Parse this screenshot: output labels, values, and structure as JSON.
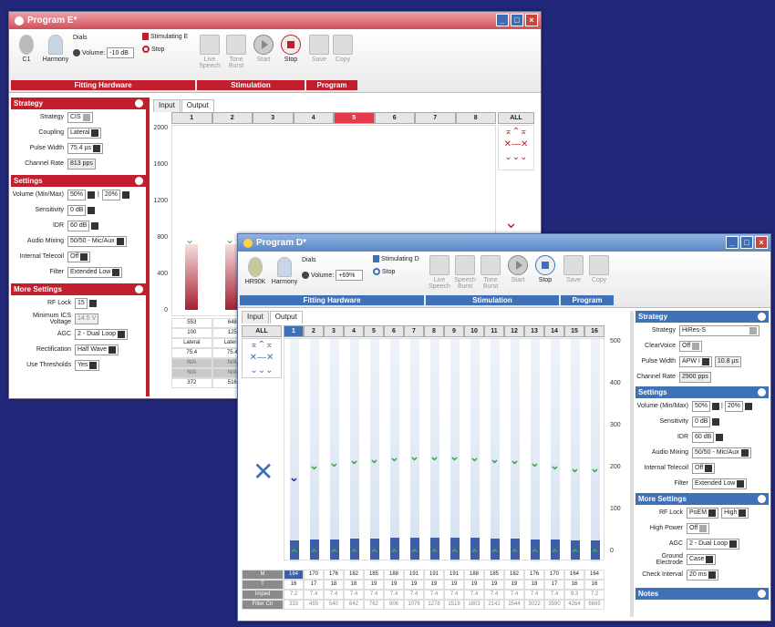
{
  "colors": {
    "red": "#c21f2e",
    "blue": "#3f71b8",
    "desktop": "#23297a"
  },
  "winE": {
    "title": "Program E*",
    "toolbar": {
      "implant": "C1",
      "processor": "Harmony",
      "dials_label": "Dials",
      "volume_label": "Volume:",
      "volume_value": "-10 dB",
      "stimulating": "Stimulating E",
      "stop_radio": "Stop",
      "live_speech": "Live Speech",
      "tone_burst": "Tone Burst",
      "start": "Start",
      "stop": "Stop",
      "save": "Save",
      "copy": "Copy",
      "group_fitting": "Fitting Hardware",
      "group_stim": "Stimulation",
      "group_program": "Program"
    },
    "strategy": {
      "header": "Strategy",
      "strategy_label": "Strategy",
      "strategy_value": "CIS",
      "coupling_label": "Coupling",
      "coupling_value": "Lateral",
      "pulse_label": "Pulse Width",
      "pulse_value": "75.4 µs",
      "rate_label": "Channel Rate",
      "rate_value": "813 pps"
    },
    "settings": {
      "header": "Settings",
      "volume_label": "Volume (Min/Max)",
      "vol_min": "50%",
      "vol_max": "20%",
      "sens_label": "Sensitivity",
      "sens_value": "0 dB",
      "idr_label": "IDR",
      "idr_value": "60 dB",
      "mix_label": "Audio Mixing",
      "mix_value": "50/50 - Mic/Aux",
      "tele_label": "Internal Telecoil",
      "tele_value": "Off",
      "filter_label": "Filter",
      "filter_value": "Extended Low"
    },
    "more": {
      "header": "More Settings",
      "rf_label": "RF Lock",
      "rf_value": "15",
      "ics_label": "Minimum ICS Voltage",
      "ics_value": "14.5 V",
      "agc_label": "AGC",
      "agc_value": "2 - Dual Loop",
      "rect_label": "Rectification",
      "rect_value": "Half Wave",
      "thresh_label": "Use Thresholds",
      "thresh_value": "Yes"
    },
    "tabs": [
      "Input",
      "Output"
    ],
    "channels": [
      "1",
      "2",
      "3",
      "4",
      "5",
      "6",
      "7",
      "8"
    ],
    "all_label": "ALL",
    "yticks": [
      "2000",
      "1600",
      "1200",
      "800",
      "400",
      "0"
    ],
    "rows": [
      [
        "553",
        "648"
      ],
      [
        "100",
        "125"
      ],
      [
        "Lateral",
        "Lateral"
      ],
      [
        "75.4",
        "75.4"
      ],
      [
        "N/A",
        "N/A"
      ],
      [
        "N/A",
        "N/A"
      ],
      [
        "372",
        "516"
      ]
    ]
  },
  "winD": {
    "title": "Program D*",
    "toolbar": {
      "implant": "HR90K",
      "processor": "Harmony",
      "dials_label": "Dials",
      "volume_label": "Volume:",
      "volume_value": "+69%",
      "stimulating": "Stimulating D",
      "stop_radio": "Stop",
      "live_speech": "Live Speech",
      "speech_burst": "Speech Burst",
      "tone_burst": "Tone Burst",
      "start": "Start",
      "stop": "Stop",
      "save": "Save",
      "copy": "Copy",
      "group_fitting": "Fitting Hardware",
      "group_stim": "Stimulation",
      "group_program": "Program"
    },
    "tabs": [
      "Input",
      "Output"
    ],
    "all_label": "ALL",
    "channels": [
      "1",
      "2",
      "3",
      "4",
      "5",
      "6",
      "7",
      "8",
      "9",
      "10",
      "11",
      "12",
      "13",
      "14",
      "15",
      "16"
    ],
    "yticks": [
      "500",
      "400",
      "300",
      "200",
      "100",
      "0"
    ],
    "row_labels": {
      "m": "M",
      "t": "T",
      "imped": "Imped",
      "filter": "Filter Ctr"
    },
    "m_values": [
      164,
      170,
      176,
      182,
      185,
      188,
      191,
      191,
      191,
      188,
      185,
      182,
      176,
      170,
      164,
      164
    ],
    "m_row": [
      "164",
      "170",
      "176",
      "182",
      "185",
      "188",
      "191",
      "191",
      "191",
      "188",
      "185",
      "182",
      "176",
      "170",
      "164",
      "164"
    ],
    "t_row": [
      "16",
      "17",
      "18",
      "18",
      "19",
      "19",
      "19",
      "19",
      "19",
      "19",
      "19",
      "19",
      "18",
      "17",
      "16",
      "16"
    ],
    "imped_row": [
      "7.2",
      "7.4",
      "7.4",
      "7.4",
      "7.4",
      "7.4",
      "7.4",
      "7.4",
      "7.4",
      "7.4",
      "7.4",
      "7.4",
      "7.4",
      "7.4",
      "9.3",
      "7.2"
    ],
    "filter_row": [
      "333",
      "455",
      "540",
      "642",
      "762",
      "906",
      "1076",
      "1278",
      "1518",
      "1803",
      "2142",
      "2544",
      "3022",
      "3590",
      "4264",
      "6665"
    ],
    "strategy": {
      "header": "Strategy",
      "strategy_label": "Strategy",
      "strategy_value": "HiRes-S",
      "clear_label": "ClearVoice",
      "clear_value": "Off",
      "pulse_label": "Pulse Width",
      "pulse_value": "APW I",
      "pulse_us": "10.8 µs",
      "rate_label": "Channel Rate",
      "rate_value": "2900 pps"
    },
    "settings": {
      "header": "Settings",
      "volume_label": "Volume (Min/Max)",
      "vol_min": "50%",
      "vol_max": "20%",
      "sens_label": "Sensitivity",
      "sens_value": "0 dB",
      "idr_label": "IDR",
      "idr_value": "60 dB",
      "mix_label": "Audio Mixing",
      "mix_value": "50/50 - Mic/Aux",
      "tele_label": "Internal Telecoil",
      "tele_value": "Off",
      "filter_label": "Filter",
      "filter_value": "Extended Low"
    },
    "more": {
      "header": "More Settings",
      "rf_label": "RF Lock",
      "rf_value": "PoEM",
      "rf_level": "High",
      "hp_label": "High Power",
      "hp_value": "Off",
      "agc_label": "AGC",
      "agc_value": "2 - Dual Loop",
      "ground_label": "Ground Electrode",
      "ground_value": "Case",
      "check_label": "Check Interval",
      "check_value": "20 ms"
    },
    "notes": {
      "header": "Notes"
    }
  }
}
